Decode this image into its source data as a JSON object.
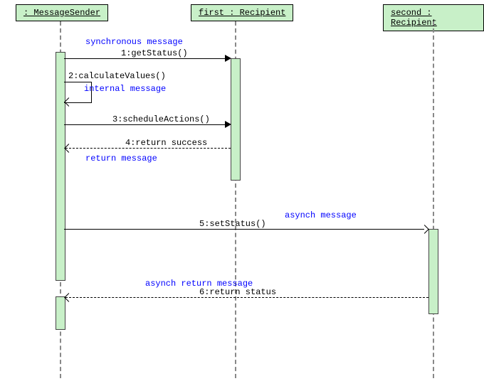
{
  "participants": {
    "sender": ": MessageSender",
    "first": "first : Recipient",
    "second": "second : Recipient"
  },
  "messages": {
    "m1": "1:getStatus()",
    "m2": "2:calculateValues()",
    "m3": "3:scheduleActions()",
    "m4": "4:return success",
    "m5": "5:setStatus()",
    "m6": "6:return status"
  },
  "notes": {
    "sync": "synchronous message",
    "internal": "internal message",
    "ret": "return message",
    "asynch": "asynch message",
    "asynch_ret": "asynch return message"
  },
  "chart_data": {
    "type": "sequence",
    "participants": [
      {
        "id": "sender",
        "name": ": MessageSender"
      },
      {
        "id": "first",
        "name": "first : Recipient"
      },
      {
        "id": "second",
        "name": "second : Recipient"
      }
    ],
    "messages": [
      {
        "seq": 1,
        "from": "sender",
        "to": "first",
        "label": "getStatus()",
        "kind": "sync",
        "note": "synchronous message"
      },
      {
        "seq": 2,
        "from": "sender",
        "to": "sender",
        "label": "calculateValues()",
        "kind": "self",
        "note": "internal message"
      },
      {
        "seq": 3,
        "from": "sender",
        "to": "first",
        "label": "scheduleActions()",
        "kind": "sync"
      },
      {
        "seq": 4,
        "from": "first",
        "to": "sender",
        "label": "return success",
        "kind": "return",
        "note": "return message"
      },
      {
        "seq": 5,
        "from": "sender",
        "to": "second",
        "label": "setStatus()",
        "kind": "async",
        "note": "asynch message"
      },
      {
        "seq": 6,
        "from": "second",
        "to": "sender",
        "label": "return status",
        "kind": "async-return",
        "note": "asynch return message"
      }
    ]
  }
}
